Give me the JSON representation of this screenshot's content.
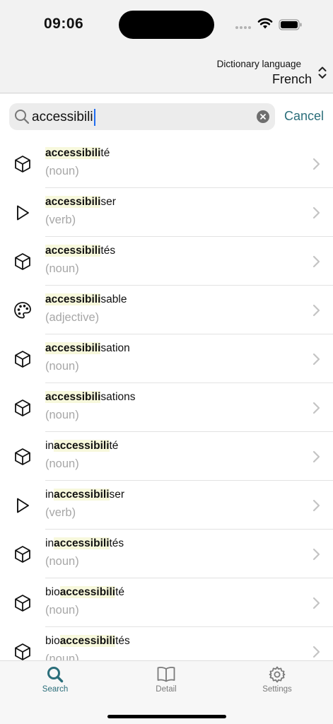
{
  "status": {
    "time": "09:06",
    "icons": [
      "signal-dots-icon",
      "wifi-icon",
      "battery-icon"
    ]
  },
  "header": {
    "language_caption": "Dictionary language",
    "language_value": "French"
  },
  "search": {
    "query": "accessibili",
    "cancel_label": "Cancel"
  },
  "results": [
    {
      "prefix": "",
      "match": "accessibili",
      "suffix": "té",
      "pos": "(noun)",
      "icon": "cube-icon"
    },
    {
      "prefix": "",
      "match": "accessibili",
      "suffix": "ser",
      "pos": "(verb)",
      "icon": "play-icon"
    },
    {
      "prefix": "",
      "match": "accessibili",
      "suffix": "tés",
      "pos": "(noun)",
      "icon": "cube-icon"
    },
    {
      "prefix": "",
      "match": "accessibili",
      "suffix": "sable",
      "pos": "(adjective)",
      "icon": "palette-icon"
    },
    {
      "prefix": "",
      "match": "accessibili",
      "suffix": "sation",
      "pos": "(noun)",
      "icon": "cube-icon"
    },
    {
      "prefix": "",
      "match": "accessibili",
      "suffix": "sations",
      "pos": "(noun)",
      "icon": "cube-icon"
    },
    {
      "prefix": "in",
      "match": "accessibili",
      "suffix": "té",
      "pos": "(noun)",
      "icon": "cube-icon"
    },
    {
      "prefix": "in",
      "match": "accessibili",
      "suffix": "ser",
      "pos": "(verb)",
      "icon": "play-icon"
    },
    {
      "prefix": "in",
      "match": "accessibili",
      "suffix": "tés",
      "pos": "(noun)",
      "icon": "cube-icon"
    },
    {
      "prefix": "bio",
      "match": "accessibili",
      "suffix": "té",
      "pos": "(noun)",
      "icon": "cube-icon"
    },
    {
      "prefix": "bio",
      "match": "accessibili",
      "suffix": "tés",
      "pos": "(noun)",
      "icon": "cube-icon"
    }
  ],
  "tabs": [
    {
      "label": "Search",
      "icon": "search-icon",
      "active": true
    },
    {
      "label": "Detail",
      "icon": "book-icon",
      "active": false
    },
    {
      "label": "Settings",
      "icon": "gear-icon",
      "active": false
    }
  ],
  "colors": {
    "accent": "#2b6e7a",
    "highlight": "#f7f8dc",
    "secondary_text": "#a7a7a7",
    "caret": "#1f6cf0"
  }
}
